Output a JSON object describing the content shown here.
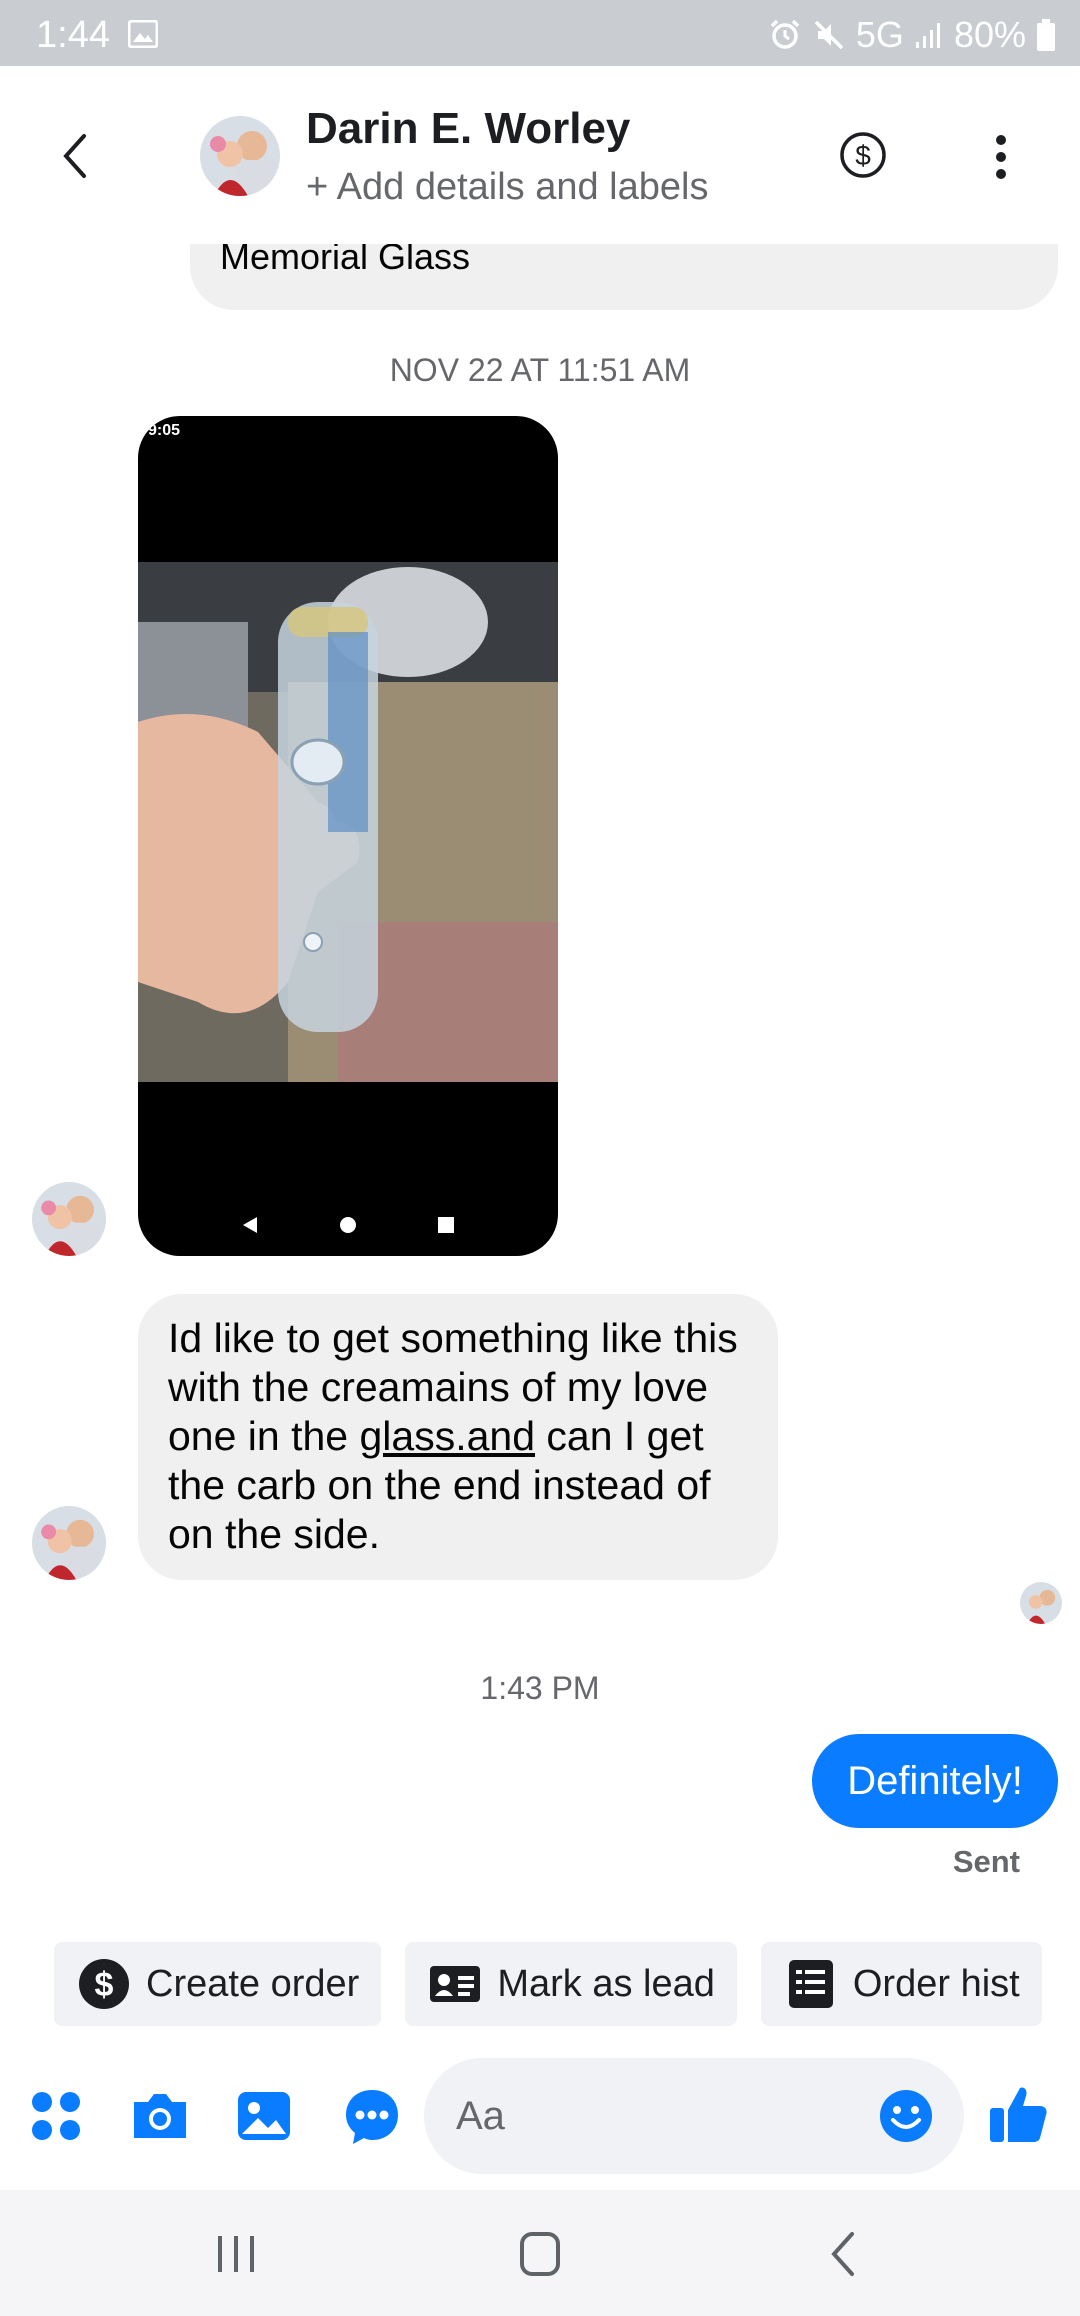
{
  "status_bar": {
    "time": "1:44",
    "network": "5G",
    "battery": "80%"
  },
  "header": {
    "contact_name": "Darin E. Worley",
    "subtitle": "+ Add details and labels"
  },
  "conversation": {
    "previous_message_tail": "Memorial Glass",
    "timestamp_1": "NOV 22 AT 11:51 AM",
    "image_status_time": "9:05",
    "incoming_text_before_link": "Id like to get something like this with the creamains of my love one in the ",
    "incoming_link": "glass.and",
    "incoming_text_after_link": " can I get the carb on the end instead of on the side.",
    "timestamp_2": "1:43 PM",
    "outgoing_text": "Definitely!",
    "delivery_status": "Sent"
  },
  "quick_actions": [
    {
      "label": "Create order",
      "icon": "dollar-circle-icon"
    },
    {
      "label": "Mark as lead",
      "icon": "id-card-icon"
    },
    {
      "label": "Order hist",
      "icon": "list-document-icon"
    }
  ],
  "composer": {
    "placeholder": "Aa"
  },
  "colors": {
    "accent": "#0a7cff",
    "bubble_gray": "#f0f0f0",
    "status_bar": "#c9ccd1"
  }
}
